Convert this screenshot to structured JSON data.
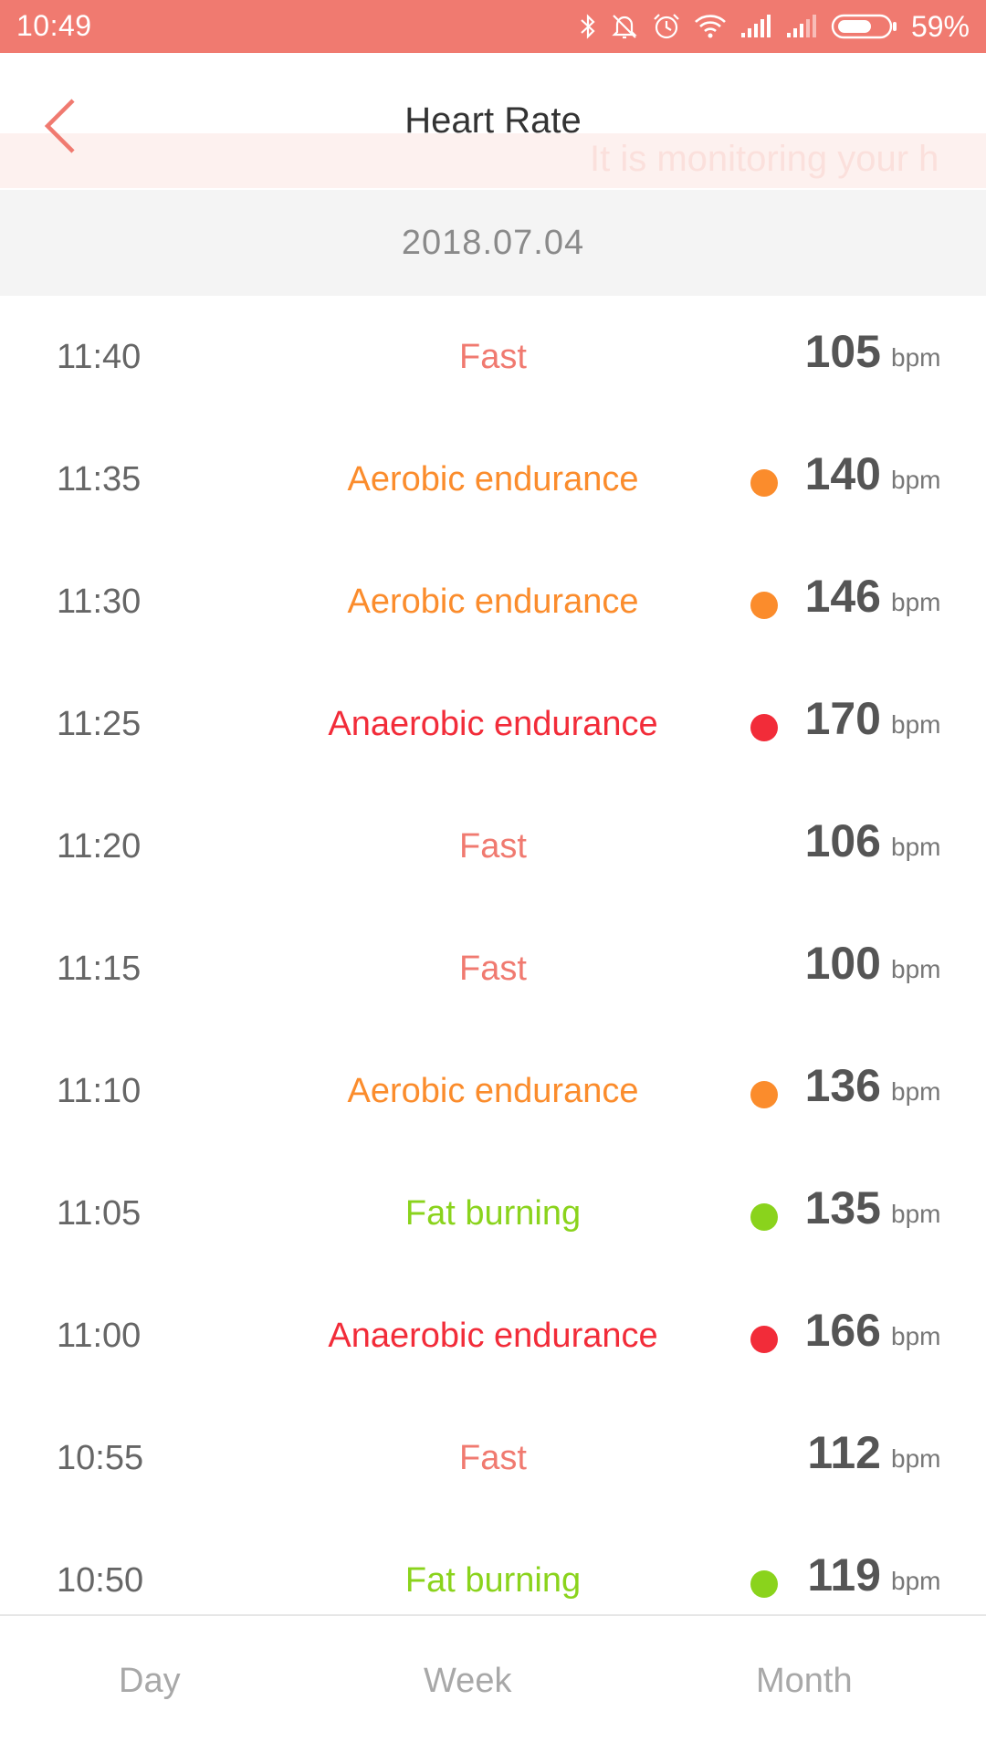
{
  "status_bar": {
    "time": "10:49",
    "battery": "59%",
    "icons": [
      "bluetooth-icon",
      "silent-icon",
      "alarm-icon",
      "wifi-icon",
      "signal-icon",
      "signal-icon",
      "battery-icon"
    ]
  },
  "header": {
    "title": "Heart Rate",
    "marquee": "It is monitoring your h"
  },
  "date": "2018.07.04",
  "unit": "bpm",
  "colors": {
    "accent": "#f07a70",
    "fast": "#f07a70",
    "aerobic": "#fb8c2c",
    "anaerobic": "#f22c39",
    "fat_burning": "#8ad31c"
  },
  "readings": [
    {
      "time": "11:40",
      "zone": "Fast",
      "zone_color": "#f07a70",
      "dot": "",
      "value": "105"
    },
    {
      "time": "11:35",
      "zone": "Aerobic endurance",
      "zone_color": "#fb8c2c",
      "dot": "#fb8c2c",
      "value": "140"
    },
    {
      "time": "11:30",
      "zone": "Aerobic endurance",
      "zone_color": "#fb8c2c",
      "dot": "#fb8c2c",
      "value": "146"
    },
    {
      "time": "11:25",
      "zone": "Anaerobic endurance",
      "zone_color": "#f22c39",
      "dot": "#f22c39",
      "value": "170"
    },
    {
      "time": "11:20",
      "zone": "Fast",
      "zone_color": "#f07a70",
      "dot": "",
      "value": "106"
    },
    {
      "time": "11:15",
      "zone": "Fast",
      "zone_color": "#f07a70",
      "dot": "",
      "value": "100"
    },
    {
      "time": "11:10",
      "zone": "Aerobic endurance",
      "zone_color": "#fb8c2c",
      "dot": "#fb8c2c",
      "value": "136"
    },
    {
      "time": "11:05",
      "zone": "Fat burning",
      "zone_color": "#8ad31c",
      "dot": "#8ad31c",
      "value": "135"
    },
    {
      "time": "11:00",
      "zone": "Anaerobic endurance",
      "zone_color": "#f22c39",
      "dot": "#f22c39",
      "value": "166"
    },
    {
      "time": "10:55",
      "zone": "Fast",
      "zone_color": "#f07a70",
      "dot": "",
      "value": "112"
    },
    {
      "time": "10:50",
      "zone": "Fat burning",
      "zone_color": "#8ad31c",
      "dot": "#8ad31c",
      "value": "119"
    }
  ],
  "nav": {
    "day": "Day",
    "week": "Week",
    "month": "Month"
  }
}
